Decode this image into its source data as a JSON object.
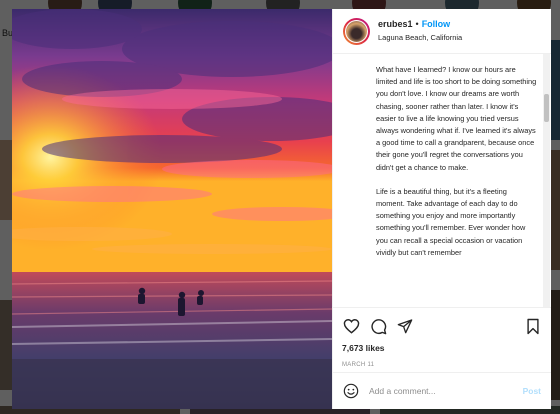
{
  "background": {
    "left_text": "Bu"
  },
  "post": {
    "username": "erubes1",
    "separator": "•",
    "follow_label": "Follow",
    "location": "Laguna Beach, California",
    "caption": [
      "What have I learned? I know our hours are limited and life is too short to be doing something you don't love. I know our dreams are worth chasing, sooner rather than later. I know it's easier to live a life knowing you tried versus always wondering what if. I've learned it's always a good time to call a grandparent, because once their gone you'll regret the conversations you didn't get a chance to make.",
      "Life is a beautiful thing, but it's a fleeting moment. Take advantage of each day to do something you enjoy and more importantly something you'll remember. Ever wonder how you can recall a special occasion or vacation vividly but can't remember"
    ],
    "likes": "7,673 likes",
    "date": "MARCH 11"
  },
  "comment_box": {
    "placeholder": "Add a comment...",
    "post_label": "Post"
  },
  "icons": {
    "like": "heart-icon",
    "comment": "comment-icon",
    "share": "send-icon",
    "save": "bookmark-icon",
    "emoji": "smiley-icon"
  },
  "colors": {
    "link": "#0095f6",
    "post_disabled": "#b2dffc",
    "text": "#262626",
    "muted": "#8e8e8e"
  }
}
